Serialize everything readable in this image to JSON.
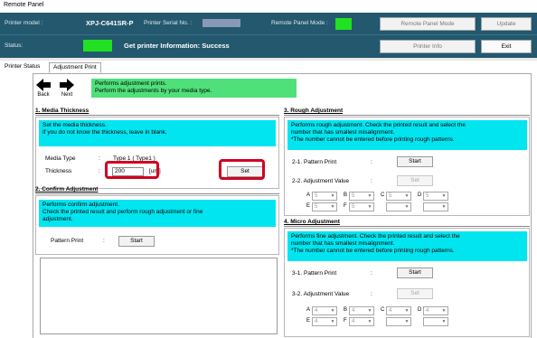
{
  "window": {
    "title": "Remote Panel"
  },
  "header": {
    "printer_model_label": "Printer model :",
    "printer_model_value": "XPJ-C641SR-P",
    "serial_label": "Printer Serial No. :",
    "remote_mode_label": "Remote Panel Mode :",
    "status_label": "Status:",
    "status_text": "Get printer Information: Success",
    "buttons": {
      "remote_panel_mode": "Remote Panel Mode",
      "update": "Update",
      "printer_info": "Printer Info",
      "exit": "Exit"
    },
    "colors": {
      "bar": "#23586e",
      "indicator": "#22e022"
    }
  },
  "tabs": [
    {
      "label": "Printer Status"
    },
    {
      "label": "Adjustment Print"
    }
  ],
  "nav": {
    "back": "Back",
    "next": "Next"
  },
  "intro": {
    "line1": "Performs adjustment prints.",
    "line2": "Perform the adjustments by your media type."
  },
  "media_thickness": {
    "title": "1.  Media Thickness",
    "desc1": "Set the media thickness.",
    "desc2": "If you do not know the thickness, leave in blank.",
    "media_type_label": "Media Type",
    "media_type_sep": ":",
    "media_type_value": "Type 1 ( Type1 )",
    "thickness_label": "Thickness",
    "thickness_sep": ":",
    "thickness_value": "200",
    "thickness_unit": "[um]",
    "set_button": "Set"
  },
  "confirm": {
    "title": "2.  Confirm Adjustment",
    "desc1": "Performs confirm adjustment.",
    "desc2": "Check the printed result and perform rough adjustment or fine",
    "desc3": "adjustment.",
    "pattern_label": "Pattern Print",
    "pattern_sep": ":",
    "start_button": "Start"
  },
  "rough": {
    "title": "3.  Rough Adjustment",
    "desc1": "Performs rough adjustment. Check the printed result and select the",
    "desc2": "number that has smallest misalignment.",
    "desc3": "  *The number cannot be entered before printing rough patterns.",
    "row1_label": "2-1.   Pattern Print",
    "row1_sep": ":",
    "start_button": "Start",
    "row2_label": "2-2.   Adjustment Value",
    "row2_sep": ":",
    "set_button": "Set",
    "combos": [
      {
        "letter": "A",
        "value": "5"
      },
      {
        "letter": "B",
        "value": "5"
      },
      {
        "letter": "C",
        "value": "5"
      },
      {
        "letter": "D",
        "value": "5"
      },
      {
        "letter": "E",
        "value": "5"
      },
      {
        "letter": "F",
        "value": "5"
      },
      {
        "letter": "",
        "value": ""
      },
      {
        "letter": "",
        "value": ""
      }
    ]
  },
  "micro": {
    "title": "4.  Micro Adjustment",
    "desc1": "Performs fine adjustment. Check the printed result and select the",
    "desc2": "number that has smallest misalignment.",
    "desc3": "  *The number cannot be entered before printing rough patterns.",
    "row1_label": "3-1.   Pattern Print",
    "row1_sep": ":",
    "start_button": "Start",
    "row2_label": "3-2.   Adjustment Value",
    "row2_sep": ":",
    "set_button": "Set",
    "combos": [
      {
        "letter": "A",
        "value": "4"
      },
      {
        "letter": "B",
        "value": "4"
      },
      {
        "letter": "C",
        "value": "4"
      },
      {
        "letter": "D",
        "value": "4"
      },
      {
        "letter": "E",
        "value": "4"
      },
      {
        "letter": "F",
        "value": "4"
      },
      {
        "letter": "",
        "value": ""
      },
      {
        "letter": "",
        "value": ""
      }
    ]
  }
}
